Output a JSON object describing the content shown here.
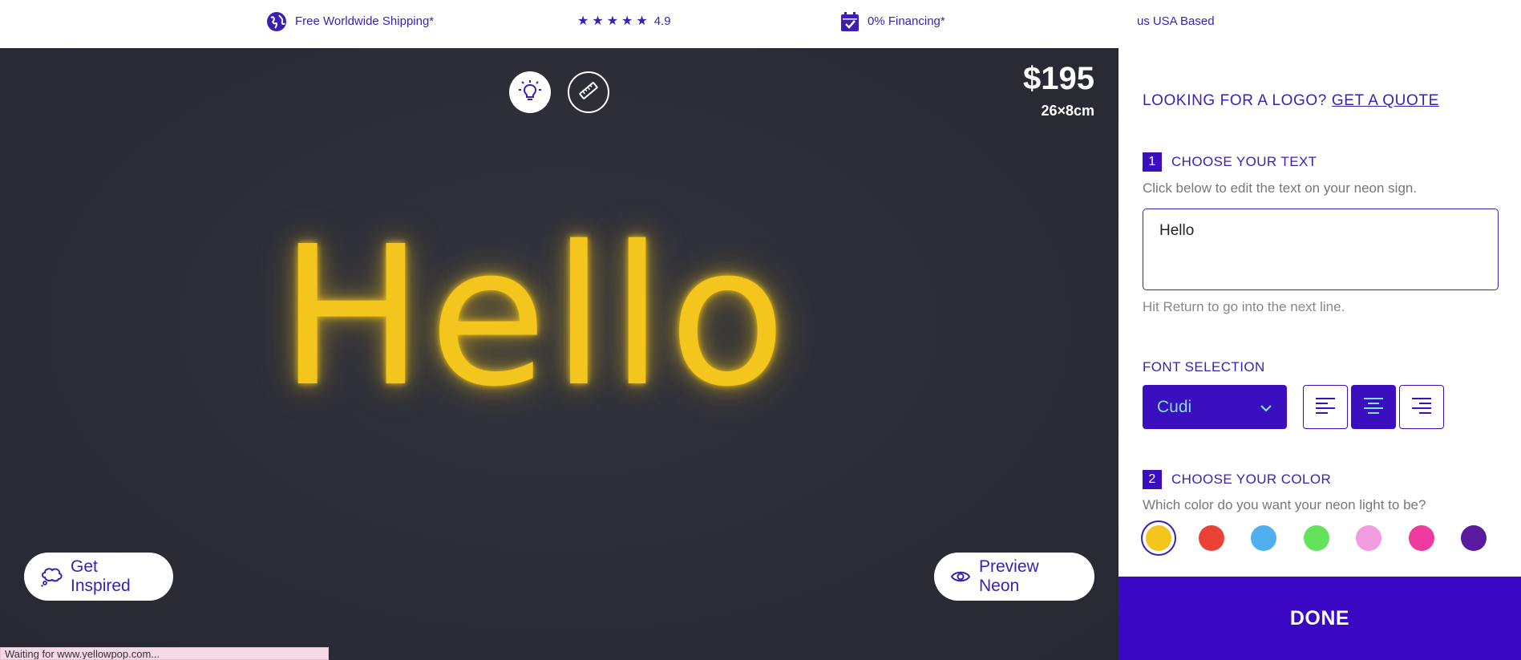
{
  "topbar": {
    "shipping": "Free Worldwide Shipping*",
    "rating": "4.9",
    "stars": 5,
    "financing": "0% Financing*",
    "usa_prefix": "us",
    "usa": "USA Based"
  },
  "stage": {
    "price": "$195",
    "size": "26×8cm",
    "neon_text": "Hello",
    "neon_color": "#f4c51c",
    "get_inspired": "Get Inspired",
    "preview": "Preview Neon"
  },
  "panel": {
    "logo_prompt": "LOOKING FOR A LOGO?",
    "logo_link": "GET A QUOTE",
    "step1": {
      "num": "1",
      "title": "CHOOSE YOUR TEXT",
      "hint": "Click below to edit the text on your neon sign."
    },
    "text_value": "Hello",
    "return_hint": "Hit Return to go into the next line.",
    "font_label": "FONT SELECTION",
    "font_value": "Cudi",
    "alignment": "center",
    "step2": {
      "num": "2",
      "title": "CHOOSE YOUR COLOR",
      "hint": "Which color do you want your neon light to be?"
    },
    "colors": [
      "#f4c51c",
      "#ea4335",
      "#4fb0f0",
      "#63e25c",
      "#f29be0",
      "#ee3b9f",
      "#5a1aa0"
    ],
    "selected_color": 0
  },
  "done": "DONE",
  "status": "Waiting for www.yellowpop.com..."
}
